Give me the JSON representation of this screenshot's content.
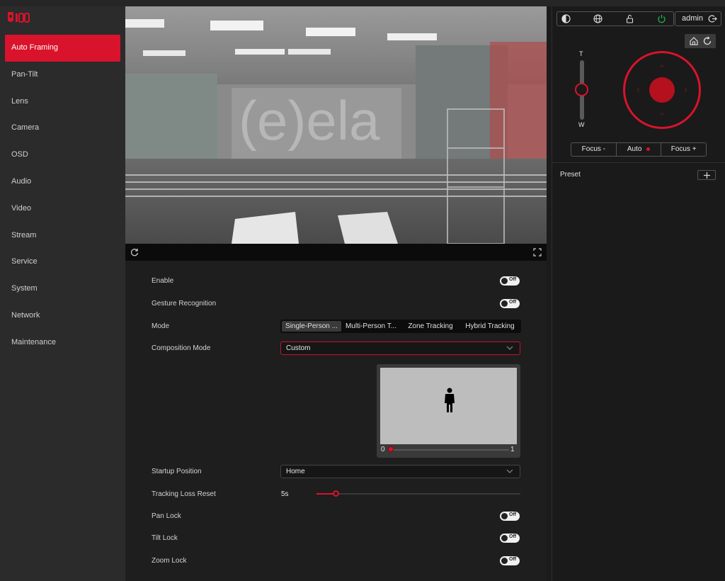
{
  "sidebar": {
    "items": [
      {
        "label": "Auto Framing",
        "active": true
      },
      {
        "label": "Pan-Tilt"
      },
      {
        "label": "Lens"
      },
      {
        "label": "Camera"
      },
      {
        "label": "OSD"
      },
      {
        "label": "Audio"
      },
      {
        "label": "Video"
      },
      {
        "label": "Stream"
      },
      {
        "label": "Service"
      },
      {
        "label": "System"
      },
      {
        "label": "Network"
      },
      {
        "label": "Maintenance"
      }
    ]
  },
  "settings": {
    "enable": {
      "label": "Enable",
      "state": "Off"
    },
    "gesture": {
      "label": "Gesture Recognition",
      "state": "Off"
    },
    "mode": {
      "label": "Mode",
      "options": [
        "Single-Person ...",
        "Multi-Person T...",
        "Zone Tracking",
        "Hybrid Tracking"
      ],
      "selected": 0
    },
    "composition": {
      "label": "Composition Mode",
      "value": "Custom"
    },
    "preview": {
      "min": "0",
      "max": "1",
      "value": 0
    },
    "startup": {
      "label": "Startup Position",
      "value": "Home"
    },
    "tracking_loss": {
      "label": "Tracking Loss Reset",
      "value": "5s",
      "fraction": 0.1
    },
    "pan_lock": {
      "label": "Pan Lock",
      "state": "Off"
    },
    "tilt_lock": {
      "label": "Tilt Lock",
      "state": "Off"
    },
    "zoom_lock": {
      "label": "Zoom Lock",
      "state": "Off"
    }
  },
  "right": {
    "user": "admin",
    "zoom": {
      "top_label": "T",
      "bottom_label": "W"
    },
    "focus": {
      "minus": "Focus -",
      "auto": "Auto",
      "plus": "Focus +"
    },
    "preset_label": "Preset"
  },
  "colors": {
    "accent": "#d9132b",
    "power": "#22b14c"
  }
}
